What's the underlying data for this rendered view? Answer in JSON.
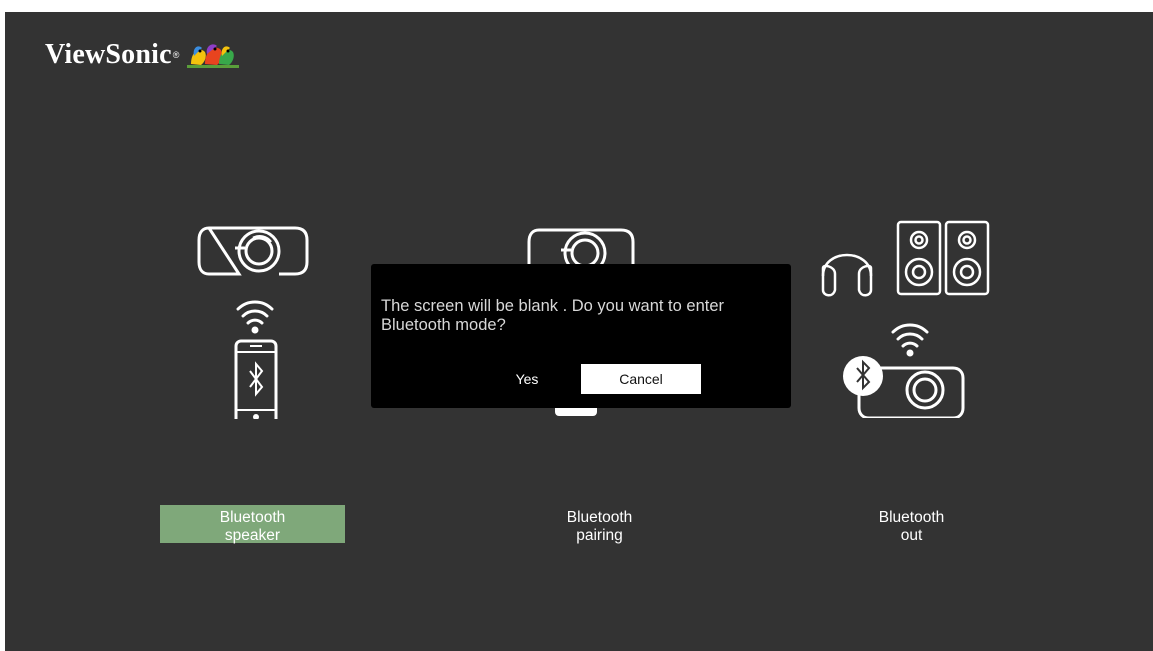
{
  "brand": {
    "name": "ViewSonic",
    "mark": "®"
  },
  "options": [
    {
      "line1": "Bluetooth",
      "line2": "speaker",
      "selected": true
    },
    {
      "line1": "Bluetooth",
      "line2": "pairing",
      "selected": false
    },
    {
      "line1": "Bluetooth",
      "line2": "out",
      "selected": false
    }
  ],
  "dialog": {
    "message": "The screen will be blank . Do you want to enter Bluetooth mode?",
    "yes_label": "Yes",
    "cancel_label": "Cancel"
  },
  "colors": {
    "background": "#333333",
    "selected": "#7fa87a",
    "dialog": "#000000"
  },
  "icons": [
    "projector-icon",
    "wifi-icon",
    "smartphone-bluetooth-icon",
    "headphones-icon",
    "speakers-icon",
    "bluetooth-icon",
    "viewsonic-birds-logo-icon"
  ]
}
